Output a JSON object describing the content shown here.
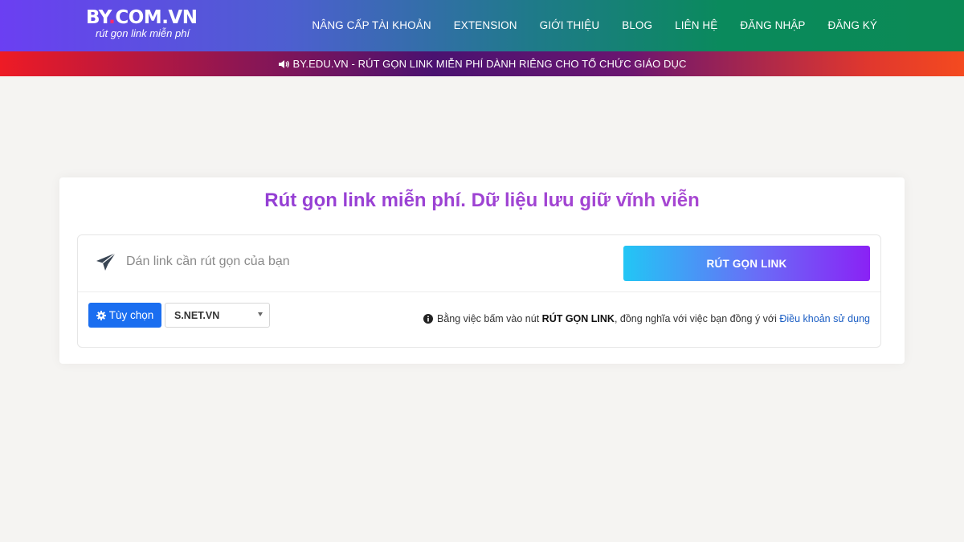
{
  "header": {
    "logo_main_a": "BY",
    "logo_dot": ".",
    "logo_main_b": "COM.VN",
    "logo_sub": "rút gọn link miễn phí",
    "nav": [
      {
        "label": "NÂNG CẤP TÀI KHOẢN"
      },
      {
        "label": "EXTENSION"
      },
      {
        "label": "GIỚI THIỆU"
      },
      {
        "label": "BLOG"
      },
      {
        "label": "LIÊN HỆ"
      },
      {
        "label": "ĐĂNG NHẬP"
      },
      {
        "label": "ĐĂNG KÝ"
      }
    ]
  },
  "banner": {
    "icon": "speaker-icon",
    "text": "BY.EDU.VN - RÚT GỌN LINK MIỄN PHÍ DÀNH RIÊNG CHO TỔ CHỨC GIÁO DỤC"
  },
  "main": {
    "title": "Rút gọn link miễn phí. Dữ liệu lưu giữ vĩnh viễn",
    "url_input": {
      "placeholder": "Dán link cần rút gọn của bạn",
      "value": ""
    },
    "shorten_label": "RÚT GỌN LINK",
    "options_label": "Tùy chọn",
    "domain_selected": "S.NET.VN",
    "terms_prefix": "Bằng việc bấm vào nút ",
    "terms_bold": "RÚT GỌN LINK",
    "terms_middle": ", đồng nghĩa với việc bạn đồng ý với ",
    "terms_link": "Điều khoản sử dụng"
  },
  "colors": {
    "accent_blue": "#1a6ef0",
    "title_purple": "#8b3bd6",
    "link_blue": "#1b5ec4"
  }
}
